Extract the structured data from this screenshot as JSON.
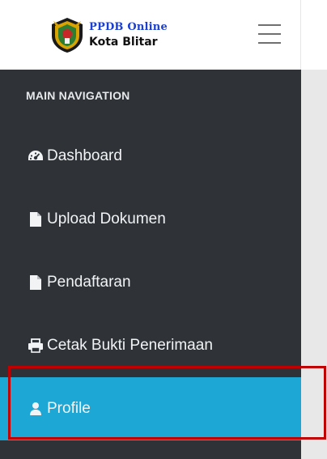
{
  "header": {
    "brand_line1": "PPDB Online",
    "brand_line2": "Kota Blitar",
    "emblem_icon": "kota-blitar-emblem",
    "menu_icon": "hamburger-icon"
  },
  "sidebar": {
    "heading": "MAIN NAVIGATION",
    "items": [
      {
        "label": "Dashboard",
        "icon": "dashboard-icon"
      },
      {
        "label": "Upload Dokumen",
        "icon": "file-icon"
      },
      {
        "label": "Pendaftaran",
        "icon": "file-icon"
      },
      {
        "label": "Cetak Bukti Penerimaan",
        "icon": "print-icon"
      },
      {
        "label": "Profile",
        "icon": "user-icon",
        "active": true
      }
    ]
  },
  "colors": {
    "sidebar_bg": "#2f3338",
    "active_bg": "#1ca7d5",
    "highlight_border": "#c00000",
    "brand_blue": "#1b3fd1"
  }
}
